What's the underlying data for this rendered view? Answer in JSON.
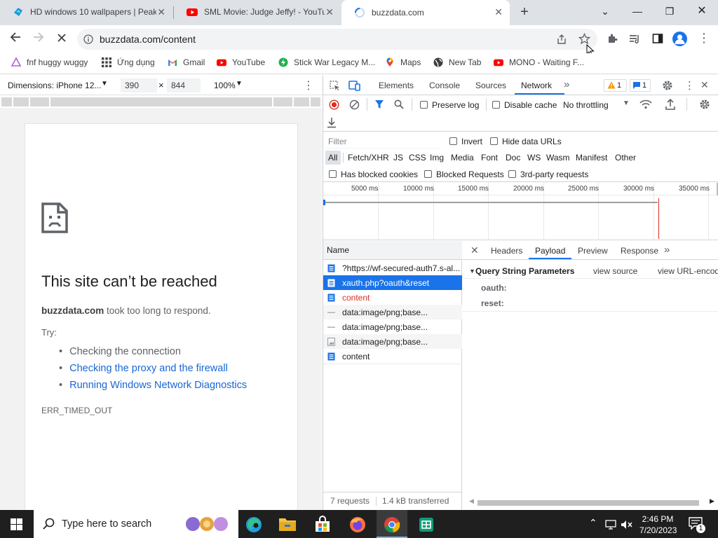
{
  "tabs": [
    {
      "title": "HD windows 10 wallpapers | Peak"
    },
    {
      "title": "SML Movie: Judge Jeffy! - YouTube"
    },
    {
      "title": "buzzdata.com"
    }
  ],
  "new_tab_label": "+",
  "address": {
    "url": "buzzdata.com/content"
  },
  "bookmarks": [
    {
      "label": "fnf huggy wuggy"
    },
    {
      "label": "Ứng dụng"
    },
    {
      "label": "Gmail"
    },
    {
      "label": "YouTube"
    },
    {
      "label": "Stick War Legacy M..."
    },
    {
      "label": "Maps"
    },
    {
      "label": "New Tab"
    },
    {
      "label": "MONO - Waiting F..."
    }
  ],
  "device_toolbar": {
    "dimensions_label": "Dimensions: iPhone 12...",
    "width": "390",
    "times": "×",
    "height": "844",
    "zoom": "100%"
  },
  "error_page": {
    "title": "This site can’t be reached",
    "host": "buzzdata.com",
    "message": " took too long to respond.",
    "try_label": "Try:",
    "suggestions": [
      "Checking the connection",
      "Checking the proxy and the firewall",
      "Running Windows Network Diagnostics"
    ],
    "code": "ERR_TIMED_OUT"
  },
  "devtools": {
    "tabs": [
      "Elements",
      "Console",
      "Sources",
      "Network"
    ],
    "more": "»",
    "warn_count": "1",
    "msg_count": "1",
    "preserve_log": "Preserve log",
    "disable_cache": "Disable cache",
    "throttling": "No throttling",
    "filter_placeholder": "Filter",
    "invert": "Invert",
    "hide_data_urls": "Hide data URLs",
    "type_filters": [
      "All",
      "Fetch/XHR",
      "JS",
      "CSS",
      "Img",
      "Media",
      "Font",
      "Doc",
      "WS",
      "Wasm",
      "Manifest",
      "Other"
    ],
    "has_blocked_cookies": "Has blocked cookies",
    "blocked_requests": "Blocked Requests",
    "third_party": "3rd-party requests",
    "timeline_ticks": [
      "5000 ms",
      "10000 ms",
      "15000 ms",
      "20000 ms",
      "25000 ms",
      "30000 ms",
      "35000 ms"
    ],
    "name_header": "Name",
    "requests": [
      {
        "name": "?https://wf-secured-auth7.s-al...",
        "kind": "doc",
        "status": "normal"
      },
      {
        "name": "xauth.php?oauth&reset",
        "kind": "doc",
        "status": "selected"
      },
      {
        "name": "content",
        "kind": "doc",
        "status": "error"
      },
      {
        "name": "data:image/png;base...",
        "kind": "dash",
        "status": "normal"
      },
      {
        "name": "data:image/png;base...",
        "kind": "dash",
        "status": "normal"
      },
      {
        "name": "data:image/png;base...",
        "kind": "img",
        "status": "normal"
      },
      {
        "name": "content",
        "kind": "doc",
        "status": "normal"
      }
    ],
    "detail_tabs": [
      "Headers",
      "Payload",
      "Preview",
      "Response"
    ],
    "query_title": "Query String Parameters",
    "view_source": "view source",
    "view_url_encoded": "view URL-encoded",
    "params": [
      "oauth:",
      "reset:"
    ],
    "summary_requests": "7 requests",
    "summary_transferred": "1.4 kB transferred"
  },
  "taskbar": {
    "search_placeholder": "Type here to search",
    "time": "2:46 PM",
    "date": "7/20/2023",
    "notifications": "1"
  },
  "colors": {
    "accent": "#1a73e8",
    "selected_row": "#1a73e8",
    "error_text": "#d93025",
    "link": "#1967d2"
  }
}
